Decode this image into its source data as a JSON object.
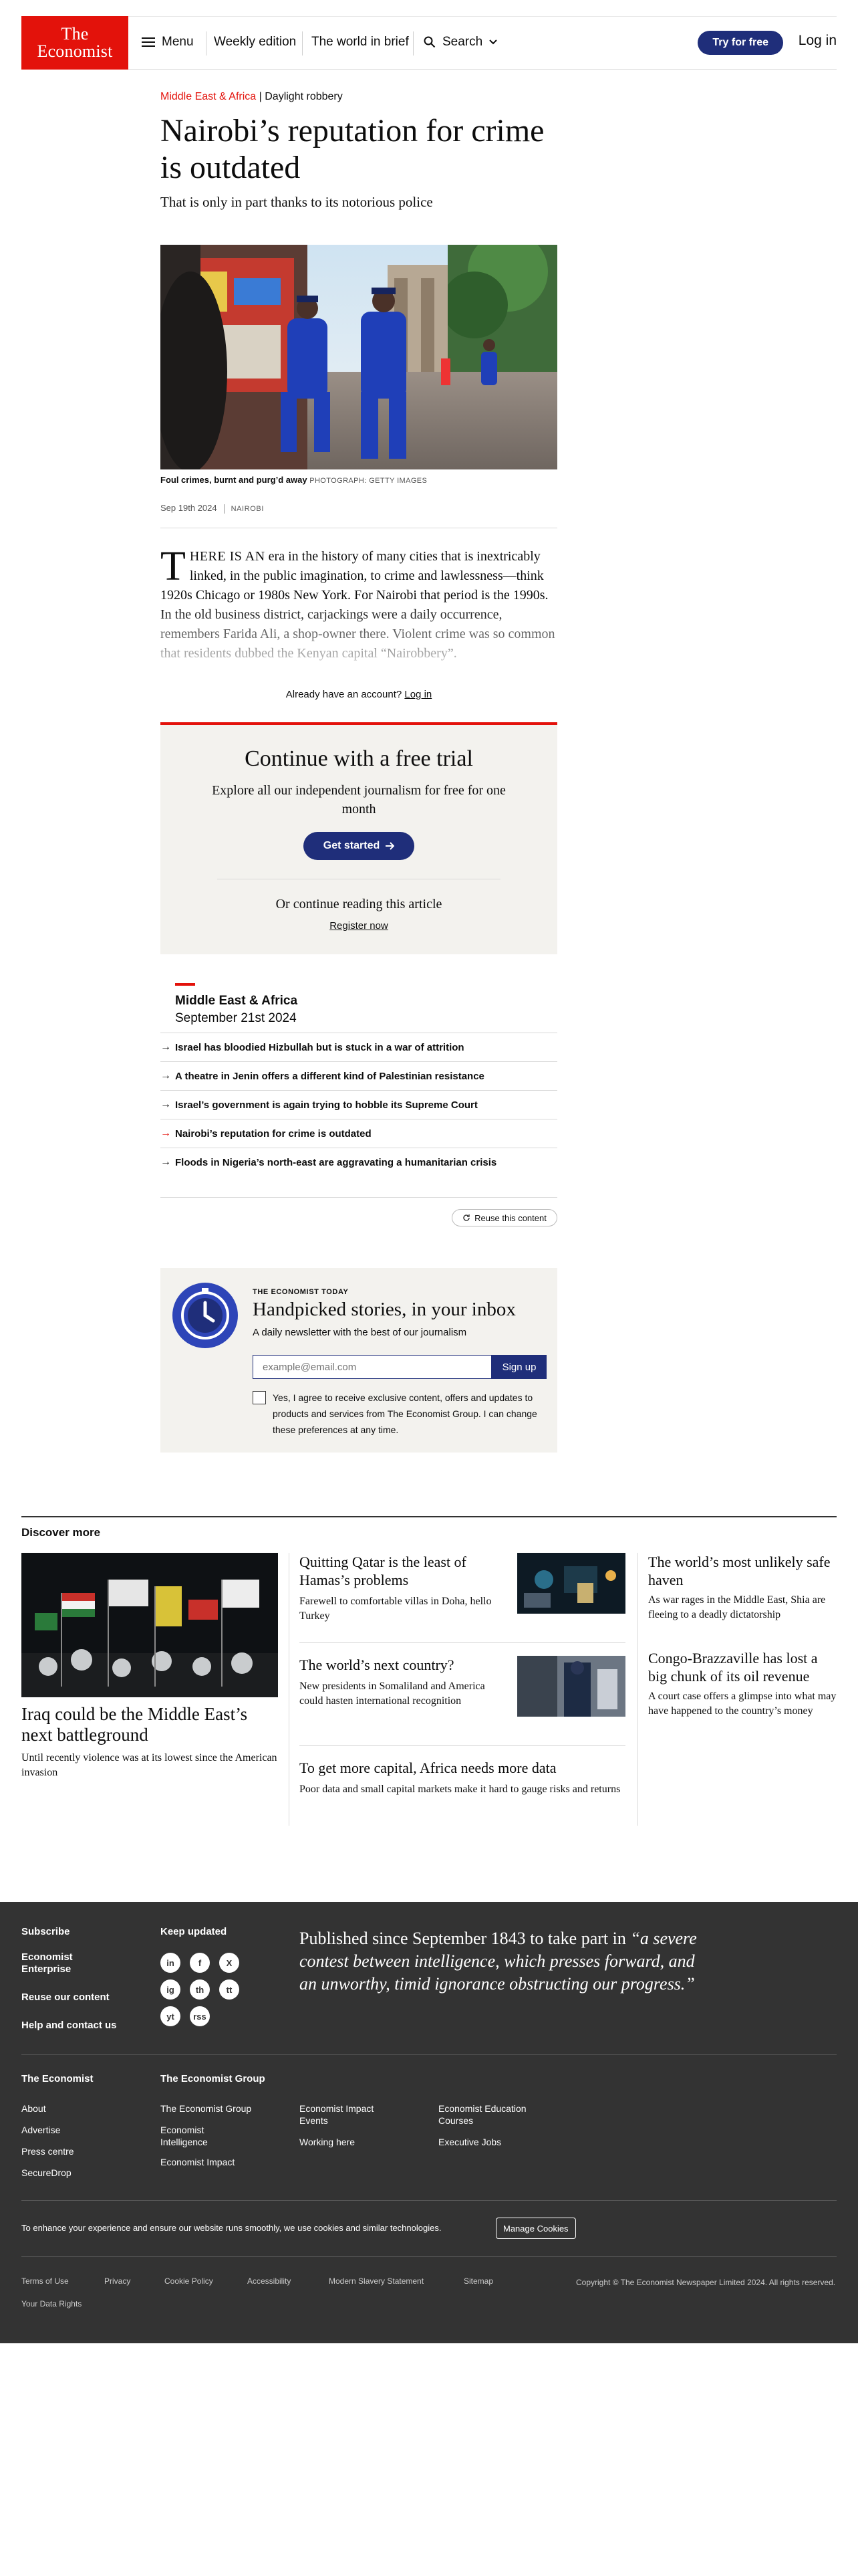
{
  "header": {
    "logo_line1": "The",
    "logo_line2": "Economist",
    "menu": "Menu",
    "weekly": "Weekly edition",
    "brief": "The world in brief",
    "search": "Search",
    "try_free": "Try for free",
    "login": "Log in"
  },
  "article": {
    "section": "Middle East & Africa",
    "rubric": "Daylight robbery",
    "title": "Nairobi’s reputation for crime is outdated",
    "subtitle": "That is only in part thanks to its notorious police",
    "caption": "Foul crimes, burnt and purg’d away",
    "caption_credit": "PHOTOGRAPH: GETTY IMAGES",
    "date": "Sep 19th 2024",
    "location": "NAIROBI",
    "drop_cap": "T",
    "lead_caps": "HERE IS AN",
    "body": " era in the history of many cities that is inextricably linked, in the public imagination, to crime and lawlessness—think 1920s Chicago or 1980s New York. For Nairobi that period is the 1990s. In the old business district, carjackings were a daily occurrence, remembers Farida Ali, a shop-owner there. Violent crime was so common that residents dubbed the Kenyan capital “Nairobbery”.",
    "already": "Already have an account?",
    "login_link": "Log in"
  },
  "trial": {
    "title": "Continue with a free trial",
    "subtitle": "Explore all our independent journalism for free for one month",
    "button": "Get started",
    "or": "Or continue reading this article",
    "register": "Register now"
  },
  "more": {
    "section": "Middle East & Africa",
    "date": "September 21st 2024",
    "items": [
      "Israel has bloodied Hizbullah but is stuck in a war of attrition",
      "A theatre in Jenin offers a different kind of Palestinian resistance",
      "Israel’s government is again trying to hobble its Supreme Court",
      "Nairobi’s reputation for crime is outdated",
      "Floods in Nigeria’s north-east are aggravating a humanitarian crisis"
    ],
    "reuse": "Reuse this content"
  },
  "newsletter": {
    "kicker": "THE ECONOMIST TODAY",
    "title": "Handpicked stories, in your inbox",
    "desc": "A daily newsletter with the best of our journalism",
    "placeholder": "example@email.com",
    "signup": "Sign up",
    "consent": "Yes, I agree to receive exclusive content, offers and updates to products and services from The Economist Group. I can change these preferences at any time."
  },
  "discover": {
    "heading": "Discover more",
    "lead_title": "Iraq could be the Middle East’s next battleground",
    "lead_sub": "Until recently violence was at its lowest since the American invasion",
    "mid": [
      {
        "title": "Quitting Qatar is the least of Hamas’s problems",
        "sub": "Farewell to comfortable villas in Doha, hello Turkey"
      },
      {
        "title": "The world’s next country?",
        "sub": "New presidents in Somaliland and America could hasten international recognition"
      },
      {
        "title": "To get more capital, Africa needs more data",
        "sub": "Poor data and small capital markets make it hard to gauge risks and returns"
      }
    ],
    "right": [
      {
        "title": "The world’s most unlikely safe haven",
        "sub": "As war rages in the Middle East, Shia are fleeing to a deadly dictatorship"
      },
      {
        "title": "Congo-Brazzaville has lost a big chunk of its oil revenue",
        "sub": "A court case offers a glimpse into what may have happened to the country’s money"
      }
    ]
  },
  "footer": {
    "subscribe": "Subscribe",
    "enterprise": "Economist Enterprise",
    "reuse": "Reuse our content",
    "help": "Help and contact us",
    "keep_updated": "Keep updated",
    "social": [
      "in",
      "f",
      "X",
      "ig",
      "th",
      "tt",
      "yt",
      "rss"
    ],
    "quote_plain": "Published since September 1843 to take part in ",
    "quote_italic": "“a severe contest between intelligence, which presses forward, and an unworthy, timid ignorance obstructing our progress.”",
    "col1_head": "The Economist",
    "col1": [
      "About",
      "Advertise",
      "Press centre",
      "SecureDrop"
    ],
    "col2_head": "The Economist Group",
    "col2": [
      "The Economist Group",
      "Economist Intelligence",
      "Economist Impact"
    ],
    "col3": [
      "Economist Impact Events",
      "Working here"
    ],
    "col4": [
      "Economist Education Courses",
      "Executive Jobs"
    ],
    "cookie_text": "To enhance your experience and ensure our website runs smoothly, we use cookies and similar technologies.",
    "manage_cookies": "Manage Cookies",
    "legal": [
      "Terms of Use",
      "Privacy",
      "Cookie Policy",
      "Accessibility",
      "Modern Slavery Statement",
      "Sitemap"
    ],
    "data_rights": "Your Data Rights",
    "copyright": "Copyright © The Economist Newspaper Limited 2024. All rights reserved."
  },
  "colors": {
    "brand_red": "#e3120b",
    "navy": "#1f2e7a",
    "footer_bg": "#333333"
  }
}
